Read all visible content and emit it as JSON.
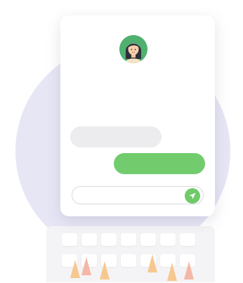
{
  "colors": {
    "background_circle": "#e6e6f5",
    "card": "#ffffff",
    "incoming_bubble": "#ececef",
    "outgoing_bubble": "#72cc6e",
    "send_button": "#6fca6a",
    "input_border": "#d9d9de"
  },
  "chat": {
    "avatar_icon": "woman-avatar-icon",
    "messages": [
      {
        "sender": "incoming",
        "text": ""
      },
      {
        "sender": "outgoing",
        "text": ""
      }
    ],
    "input": {
      "value": "",
      "placeholder": ""
    },
    "send_icon": "paper-plane-icon"
  },
  "keyboard_icon": "keyboard-icon"
}
